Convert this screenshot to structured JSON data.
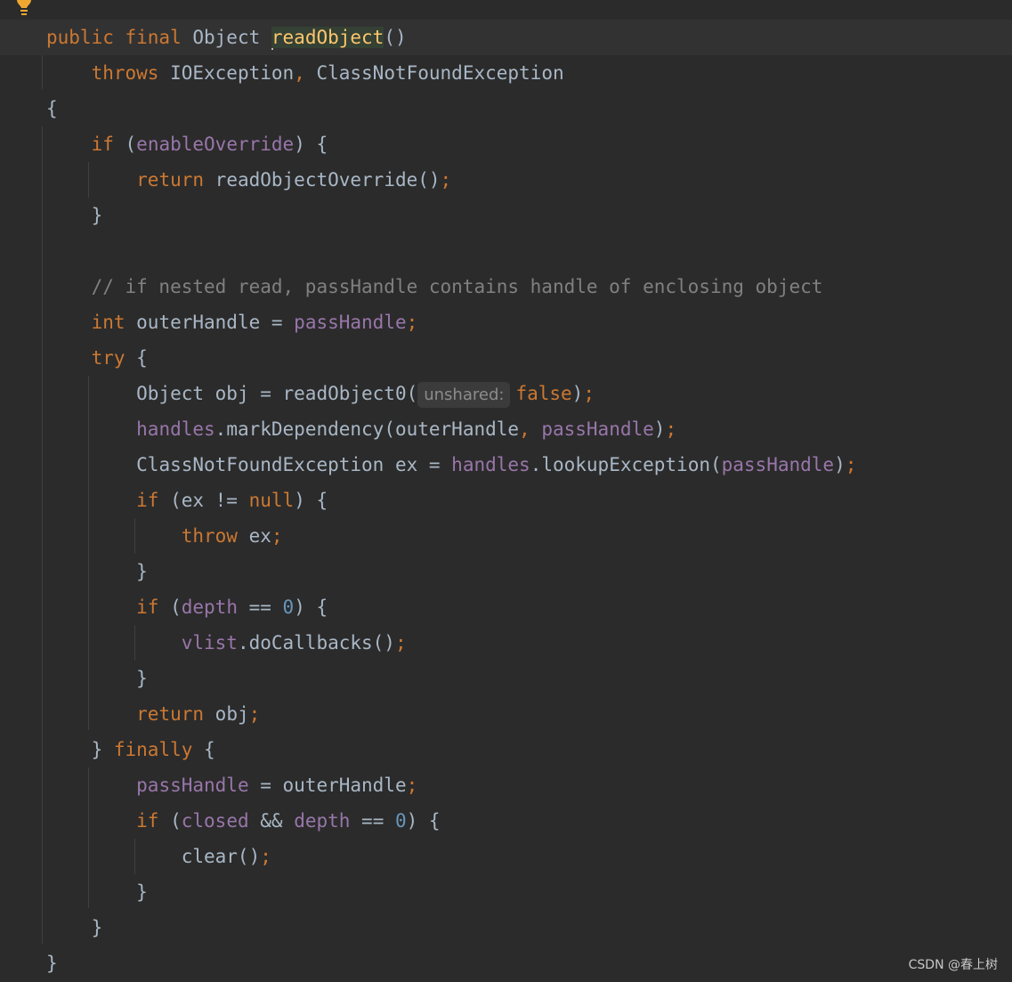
{
  "editor": {
    "caret_line": 1,
    "lines": [
      {
        "tokens": [
          {
            "t": "public final ",
            "c": "kw"
          },
          {
            "t": "Object ",
            "c": "plain"
          },
          {
            "t": "readObject",
            "c": "method-decl",
            "caret": true
          },
          {
            "t": "()",
            "c": "plain"
          }
        ]
      },
      {
        "tokens": [
          {
            "t": "    "
          },
          {
            "t": "throws ",
            "c": "kw"
          },
          {
            "t": "IOException",
            "c": "plain"
          },
          {
            "t": ", ",
            "c": "kw"
          },
          {
            "t": "ClassNotFoundException",
            "c": "plain"
          }
        ]
      },
      {
        "tokens": [
          {
            "t": "{",
            "c": "plain"
          }
        ]
      },
      {
        "tokens": [
          {
            "t": "    "
          },
          {
            "t": "if ",
            "c": "kw"
          },
          {
            "t": "(",
            "c": "plain"
          },
          {
            "t": "enableOverride",
            "c": "field"
          },
          {
            "t": ") {",
            "c": "plain"
          }
        ]
      },
      {
        "tokens": [
          {
            "t": "        "
          },
          {
            "t": "return ",
            "c": "kw"
          },
          {
            "t": "readObjectOverride()",
            "c": "plain"
          },
          {
            "t": ";",
            "c": "semi"
          }
        ]
      },
      {
        "tokens": [
          {
            "t": "    "
          },
          {
            "t": "}",
            "c": "plain"
          }
        ]
      },
      {
        "tokens": []
      },
      {
        "tokens": [
          {
            "t": "    "
          },
          {
            "t": "// if nested read, passHandle contains handle of enclosing object",
            "c": "comment"
          }
        ]
      },
      {
        "tokens": [
          {
            "t": "    "
          },
          {
            "t": "int ",
            "c": "kw"
          },
          {
            "t": "outerHandle = ",
            "c": "plain"
          },
          {
            "t": "passHandle",
            "c": "field"
          },
          {
            "t": ";",
            "c": "semi"
          }
        ]
      },
      {
        "tokens": [
          {
            "t": "    "
          },
          {
            "t": "try ",
            "c": "kw"
          },
          {
            "t": "{",
            "c": "plain"
          }
        ]
      },
      {
        "tokens": [
          {
            "t": "        "
          },
          {
            "t": "Object obj = readObject0(",
            "c": "plain"
          },
          {
            "t": "unshared:",
            "c": "hint"
          },
          {
            "t": "false",
            "c": "kw"
          },
          {
            "t": ")",
            "c": "plain"
          },
          {
            "t": ";",
            "c": "semi"
          }
        ]
      },
      {
        "tokens": [
          {
            "t": "        "
          },
          {
            "t": "handles",
            "c": "field"
          },
          {
            "t": ".markDependency(outerHandle",
            "c": "plain"
          },
          {
            "t": ", ",
            "c": "kw"
          },
          {
            "t": "passHandle",
            "c": "field"
          },
          {
            "t": ")",
            "c": "plain"
          },
          {
            "t": ";",
            "c": "semi"
          }
        ]
      },
      {
        "tokens": [
          {
            "t": "        "
          },
          {
            "t": "ClassNotFoundException ex = ",
            "c": "plain"
          },
          {
            "t": "handles",
            "c": "field"
          },
          {
            "t": ".lookupException(",
            "c": "plain"
          },
          {
            "t": "passHandle",
            "c": "field"
          },
          {
            "t": ")",
            "c": "plain"
          },
          {
            "t": ";",
            "c": "semi"
          }
        ]
      },
      {
        "tokens": [
          {
            "t": "        "
          },
          {
            "t": "if ",
            "c": "kw"
          },
          {
            "t": "(ex != ",
            "c": "plain"
          },
          {
            "t": "null",
            "c": "kw"
          },
          {
            "t": ") {",
            "c": "plain"
          }
        ]
      },
      {
        "tokens": [
          {
            "t": "            "
          },
          {
            "t": "throw ",
            "c": "kw"
          },
          {
            "t": "ex",
            "c": "plain"
          },
          {
            "t": ";",
            "c": "semi"
          }
        ]
      },
      {
        "tokens": [
          {
            "t": "        "
          },
          {
            "t": "}",
            "c": "plain"
          }
        ]
      },
      {
        "tokens": [
          {
            "t": "        "
          },
          {
            "t": "if ",
            "c": "kw"
          },
          {
            "t": "(",
            "c": "plain"
          },
          {
            "t": "depth",
            "c": "field"
          },
          {
            "t": " == ",
            "c": "plain"
          },
          {
            "t": "0",
            "c": "num"
          },
          {
            "t": ") {",
            "c": "plain"
          }
        ]
      },
      {
        "tokens": [
          {
            "t": "            "
          },
          {
            "t": "vlist",
            "c": "field"
          },
          {
            "t": ".doCallbacks()",
            "c": "plain"
          },
          {
            "t": ";",
            "c": "semi"
          }
        ]
      },
      {
        "tokens": [
          {
            "t": "        "
          },
          {
            "t": "}",
            "c": "plain"
          }
        ]
      },
      {
        "tokens": [
          {
            "t": "        "
          },
          {
            "t": "return ",
            "c": "kw"
          },
          {
            "t": "obj",
            "c": "plain"
          },
          {
            "t": ";",
            "c": "semi"
          }
        ]
      },
      {
        "tokens": [
          {
            "t": "    "
          },
          {
            "t": "} ",
            "c": "plain"
          },
          {
            "t": "finally ",
            "c": "kw"
          },
          {
            "t": "{",
            "c": "plain"
          }
        ]
      },
      {
        "tokens": [
          {
            "t": "        "
          },
          {
            "t": "passHandle",
            "c": "field"
          },
          {
            "t": " = outerHandle",
            "c": "plain"
          },
          {
            "t": ";",
            "c": "semi"
          }
        ]
      },
      {
        "tokens": [
          {
            "t": "        "
          },
          {
            "t": "if ",
            "c": "kw"
          },
          {
            "t": "(",
            "c": "plain"
          },
          {
            "t": "closed",
            "c": "field"
          },
          {
            "t": " && ",
            "c": "plain"
          },
          {
            "t": "depth",
            "c": "field"
          },
          {
            "t": " == ",
            "c": "plain"
          },
          {
            "t": "0",
            "c": "num"
          },
          {
            "t": ") {",
            "c": "plain"
          }
        ]
      },
      {
        "tokens": [
          {
            "t": "            "
          },
          {
            "t": "clear()",
            "c": "plain"
          },
          {
            "t": ";",
            "c": "semi"
          }
        ]
      },
      {
        "tokens": [
          {
            "t": "        "
          },
          {
            "t": "}",
            "c": "plain"
          }
        ]
      },
      {
        "tokens": [
          {
            "t": "    "
          },
          {
            "t": "}",
            "c": "plain"
          }
        ]
      },
      {
        "tokens": [
          {
            "t": "}",
            "c": "plain"
          }
        ]
      }
    ]
  },
  "gutter": {
    "icon": "lightbulb-icon",
    "color": "#f0a732"
  },
  "colors": {
    "background": "#2b2b2b",
    "keyword": "#cc7832",
    "field": "#9876aa",
    "number": "#6897bb",
    "comment": "#808080",
    "text": "#a9b7c6",
    "method_declaration": "#ffc66d"
  },
  "watermark": "CSDN @春上树"
}
